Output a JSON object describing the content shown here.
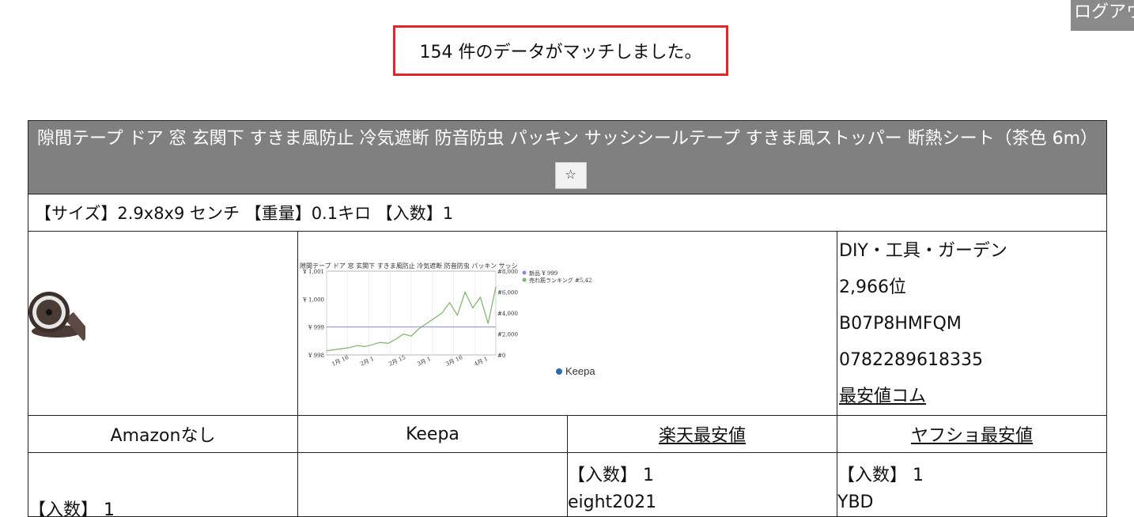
{
  "logout_label": "ログアウト",
  "match_text": "154 件のデータがマッチしました。",
  "product": {
    "title": "隙間テープ ドア 窓 玄関下 すきま風防止 冷気遮断 防音防虫 パッキン サッシシールテープ すきま風ストッパー 断熱シート（茶色 6m）",
    "star_label": "☆",
    "spec": "【サイズ】2.9x8x9 センチ 【重量】0.1キロ 【入数】1",
    "category": "DIY・工具・ガーデン",
    "rank": "2,966位",
    "asin": "B07P8HMFQM",
    "jan": "0782289618335",
    "cheapest_link": "最安値コム"
  },
  "links": {
    "amazon": "Amazonなし",
    "keepa": "Keepa",
    "rakuten": "楽天最安値",
    "yahoo": "ヤフショ最安値"
  },
  "bottom": {
    "left_qty": "【入数】 1",
    "rakuten_qty": "【入数】 1",
    "rakuten_shop": "eight2021",
    "yahoo_qty": "【入数】 1",
    "yahoo_shop": "YBD"
  },
  "chart_data": {
    "type": "line",
    "title": "隙間テープ ドア 窓 玄関下 すきま風防止 冷気遮断 防音防虫 パッキン サッシ",
    "x_ticks": [
      "1月 16",
      "2月 1",
      "2月 15",
      "3月 1",
      "3月 16",
      "4月 1"
    ],
    "y_left_ticks": [
      "¥ 1,001",
      "¥ 1,000",
      "¥ 999",
      "¥ 998"
    ],
    "y_right_ticks": [
      "#8,000",
      "#6,000",
      "#4,000",
      "#2,000",
      "#0"
    ],
    "legend": [
      "新品 ¥ 999",
      "売れ筋ランキング #5,42"
    ],
    "series": [
      {
        "name": "新品 ¥ 999",
        "color": "#8a8ae6",
        "values": [
          999,
          999,
          999,
          999,
          999,
          999,
          999
        ]
      },
      {
        "name": "売れ筋ランキング #5,42",
        "color": "#7fb26b",
        "values": [
          400,
          500,
          600,
          700,
          900,
          800,
          1000,
          1200,
          1100,
          1500,
          2000,
          1800,
          2500,
          3000,
          3500,
          4000,
          5000,
          3800,
          6000,
          4500,
          5500,
          3000,
          6500
        ]
      }
    ],
    "brand": "Keepa"
  }
}
